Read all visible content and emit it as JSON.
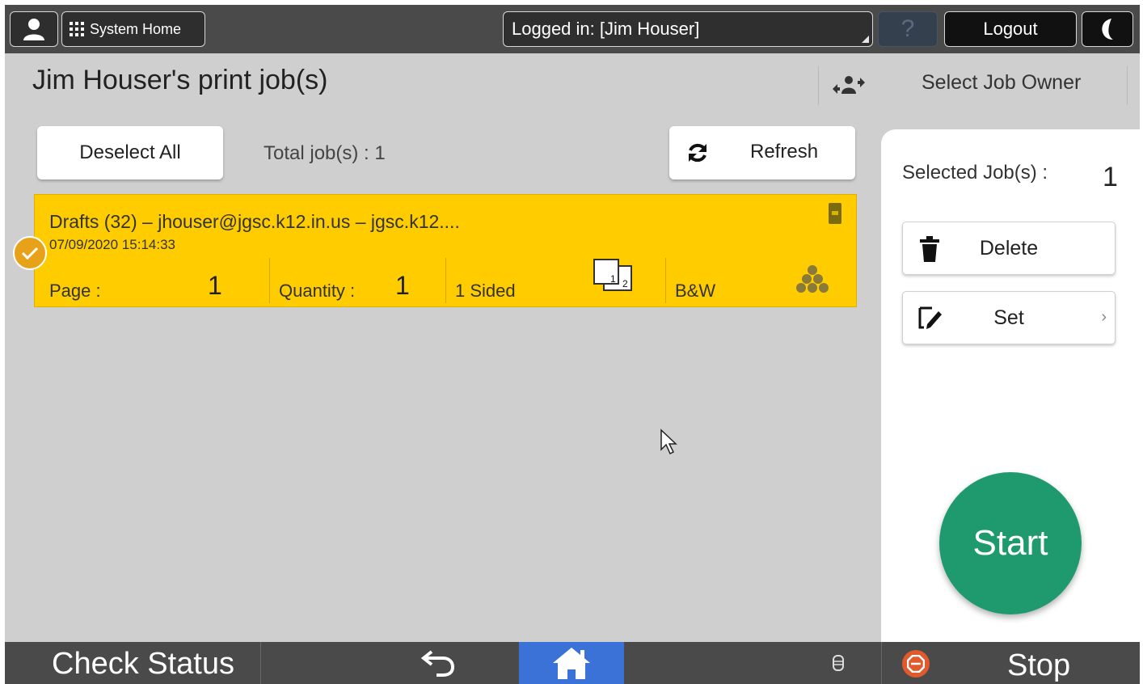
{
  "topbar": {
    "system_home_label": "System Home",
    "login_text": "Logged in: [Jim Houser]",
    "help_symbol": "?",
    "logout_label": "Logout"
  },
  "header": {
    "title": "Jim Houser's print job(s)",
    "select_owner_label": "Select Job Owner"
  },
  "actions": {
    "deselect_label": "Deselect All",
    "total_label": "Total job(s) : 1",
    "refresh_label": "Refresh"
  },
  "jobs": [
    {
      "title": "Drafts (32) – jhouser@jgsc.k12.in.us – jgsc.k12....",
      "datetime": "07/09/2020 15:14:33",
      "page_label": "Page :",
      "page_value": "1",
      "quantity_label": "Quantity :",
      "quantity_value": "1",
      "sides": "1 Sided",
      "color_mode": "B&W"
    }
  ],
  "panel": {
    "selected_label": "Selected Job(s) :",
    "selected_count": "1",
    "delete_label": "Delete",
    "set_label": "Set",
    "start_label": "Start"
  },
  "bottombar": {
    "check_status_label": "Check Status",
    "stop_label": "Stop"
  },
  "colors": {
    "job_highlight": "#ffcc00",
    "start_button": "#1f9a6e",
    "home_active": "#3a72d8",
    "stop_icon": "#e05a2e",
    "check_badge": "#e8a21a"
  },
  "icons": [
    "user-icon",
    "apps-grid-icon",
    "help-icon",
    "moon-icon",
    "owner-swap-icon",
    "refresh-icon",
    "check-icon",
    "print-flag-icon",
    "duplex-icon",
    "color-toner-icon",
    "trash-icon",
    "edit-icon",
    "chevron-right-icon",
    "back-arrow-icon",
    "home-icon",
    "storage-icon",
    "stop-icon"
  ]
}
